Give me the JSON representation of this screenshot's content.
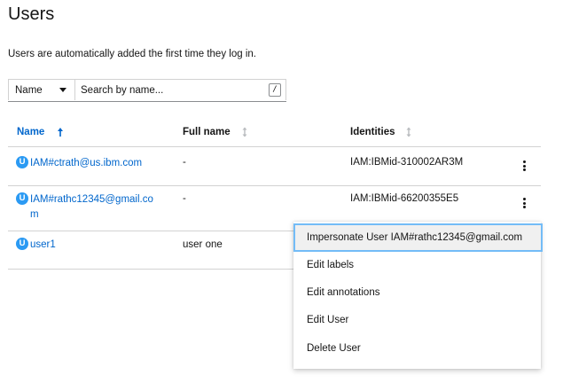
{
  "page": {
    "title": "Users",
    "description": "Users are automatically added the first time they log in."
  },
  "filter": {
    "selected": "Name",
    "search_placeholder": "Search by name...",
    "shortcut_hint": "/"
  },
  "table": {
    "headers": {
      "name": "Name",
      "full_name": "Full name",
      "identities": "Identities"
    },
    "rows": [
      {
        "badge": "U",
        "name": "IAM#ctrath@us.ibm.com",
        "full_name": "-",
        "identities": "IAM:IBMid-310002AR3M"
      },
      {
        "badge": "U",
        "name_line1": "IAM#rathc12345@gmail.co",
        "name_line2": "m",
        "full_name": "-",
        "identities": "IAM:IBMid-66200355E5"
      },
      {
        "badge": "U",
        "name": "user1",
        "full_name": "user one",
        "identities": ""
      }
    ]
  },
  "actions_menu": {
    "items": [
      "Impersonate User IAM#rathc12345@gmail.com",
      "Edit labels",
      "Edit annotations",
      "Edit User",
      "Delete User"
    ]
  },
  "colors": {
    "link": "#0066cc",
    "badge": "#2b9af3",
    "focus_ring": "#73bcf7",
    "border": "#d2d2d2"
  },
  "icons": {
    "sort_active": "sort-ascending-icon",
    "sort_inactive": "sort-icon",
    "row_actions": "kebab-icon",
    "user_badge": "user-badge-icon"
  }
}
